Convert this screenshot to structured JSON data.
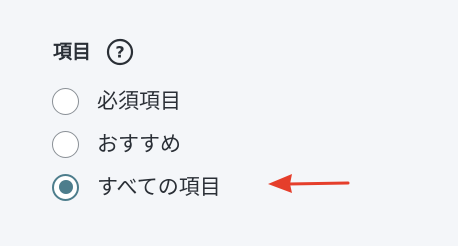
{
  "field": {
    "label": "項目"
  },
  "help_icon": {
    "name": "help-circle-icon",
    "glyph": "?"
  },
  "options": [
    {
      "label": "必須項目",
      "selected": false
    },
    {
      "label": "おすすめ",
      "selected": false
    },
    {
      "label": "すべての項目",
      "selected": true
    }
  ],
  "colors": {
    "text": "#2a2f36",
    "radio_selected": "#4d7d8c",
    "radio_border": "#8a9096",
    "annotation_arrow": "#e53e2b",
    "background": "#f4f6f9"
  }
}
